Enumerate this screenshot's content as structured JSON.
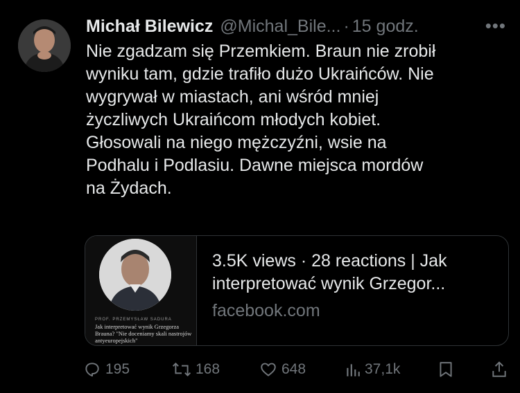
{
  "author": {
    "name": "Michał Bilewicz",
    "handle": "@Michal_Bile...",
    "time": "15 godz."
  },
  "tweet": {
    "lines": [
      "Nie zgadzam się Przemkiem. Braun nie zrobił",
      "wyniku tam, gdzie trafiło dużo Ukraińców. Nie",
      "wygrywał w miastach, ani wśród mniej",
      "życzliwych Ukraińcom młodych kobiet.",
      "Głosowali na niego mężczyźni, wsie na",
      "Podhalu i Podlasiu. Dawne miejsca mordów",
      "na Żydach."
    ]
  },
  "card": {
    "title_line1": "3.5K views · 28 reactions | Jak",
    "title_line2": "interpretować wynik Grzegor...",
    "domain": "facebook.com",
    "thumb_author": "PROF. PRZEMYSŁAW SADURA",
    "thumb_caption": "Jak interpretować wynik Grzegorza Brauna? \"Nie doceniamy skali nastrojów antyeuropejskich\""
  },
  "actions": {
    "replies": "195",
    "reposts": "168",
    "likes": "648",
    "views": "37,1k"
  },
  "icons": {
    "reply": "reply-icon",
    "repost": "repost-icon",
    "like": "heart-icon",
    "views": "views-icon",
    "bookmark": "bookmark-icon",
    "share": "share-icon",
    "more": "more-icon"
  },
  "colors": {
    "background": "#000000",
    "text": "#e7e9ea",
    "secondary": "#71767b",
    "border": "#2f3336"
  }
}
